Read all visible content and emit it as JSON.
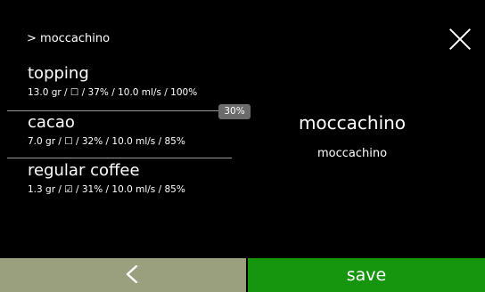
{
  "header": {
    "breadcrumb": "> moccachino",
    "close_icon": "close-icon"
  },
  "ingredients": [
    {
      "name": "topping",
      "details": "13.0 gr / ☐ / 37% / 10.0 ml/s / 100%"
    },
    {
      "name": "cacao",
      "details": "7.0 gr / ☐ / 32% / 10.0 ml/s / 85%"
    },
    {
      "name": "regular coffee",
      "details": "1.3 gr / ☑ / 31% / 10.0 ml/s / 85%"
    }
  ],
  "percent_badge": "30%",
  "product": {
    "title": "moccachino",
    "subtitle": "moccachino"
  },
  "footer": {
    "back_icon": "chevron-left-icon",
    "save_label": "save"
  },
  "colors": {
    "background": "#000000",
    "back_button": "#9a9f7e",
    "save_button": "#16960e",
    "badge": "#6b6b6b",
    "divider": "#9a9a9a"
  }
}
